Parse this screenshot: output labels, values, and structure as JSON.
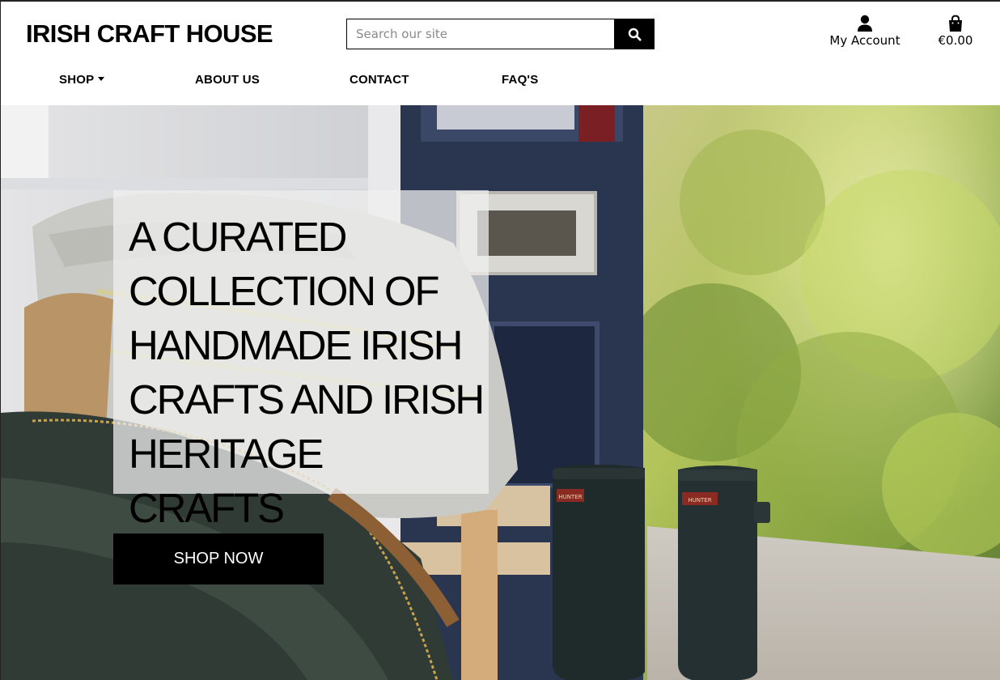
{
  "brand": {
    "name": "IRISH CRAFT HOUSE"
  },
  "search": {
    "placeholder": "Search our site",
    "value": "",
    "icon": "search-icon"
  },
  "account": {
    "label": "My Account",
    "icon": "user-icon"
  },
  "cart": {
    "total": "€0.00",
    "icon": "shopping-bag-icon"
  },
  "nav": {
    "items": [
      {
        "label": "SHOP",
        "has_dropdown": true
      },
      {
        "label": "ABOUT US",
        "has_dropdown": false
      },
      {
        "label": "CONTACT",
        "has_dropdown": false
      },
      {
        "label": "FAQ'S",
        "has_dropdown": false
      }
    ]
  },
  "hero": {
    "headline": "A CURATED COLLECTION OF HANDMADE IRISH CRAFTS AND IRISH HERITAGE CRAFTS",
    "cta_label": "SHOP NOW",
    "boot_brand": "HUNTER"
  },
  "colors": {
    "text": "#000000",
    "button_bg": "#000000",
    "button_text": "#ffffff",
    "header_bg": "#ffffff",
    "door_blue": "#2a3550"
  }
}
